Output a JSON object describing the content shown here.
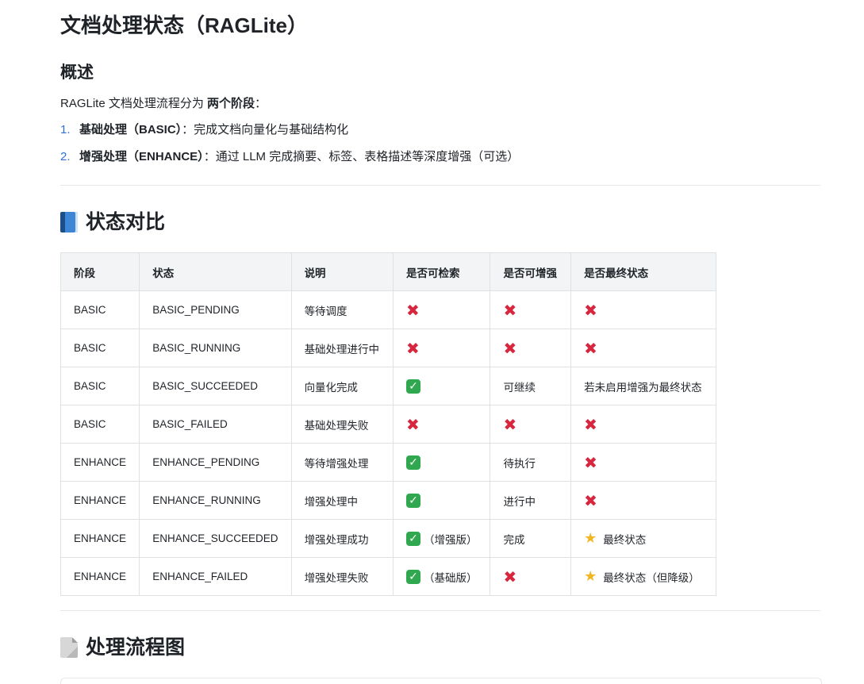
{
  "title": "文档处理状态（RAGLite）",
  "overview": {
    "heading": "概述",
    "intro_prefix": "RAGLite 文档处理流程分为 ",
    "intro_bold": "两个阶段",
    "intro_suffix": "：",
    "stages": [
      {
        "num": "1.",
        "name": "基础处理（BASIC）",
        "desc": "：完成文档向量化与基础结构化"
      },
      {
        "num": "2.",
        "name": "增强处理（ENHANCE）",
        "desc": "：通过 LLM 完成摘要、标签、表格描述等深度增强（可选）"
      }
    ]
  },
  "comparison": {
    "heading": "状态对比",
    "icon": "blue-book-icon",
    "headers": [
      "阶段",
      "状态",
      "说明",
      "是否可检索",
      "是否可增强",
      "是否最终状态"
    ],
    "rows": [
      {
        "stage": "BASIC",
        "status": "BASIC_PENDING",
        "desc": "等待调度",
        "searchable": {
          "mark": "cross",
          "note": ""
        },
        "enhanceable": {
          "mark": "cross",
          "note": ""
        },
        "final": {
          "mark": "cross",
          "note": ""
        }
      },
      {
        "stage": "BASIC",
        "status": "BASIC_RUNNING",
        "desc": "基础处理进行中",
        "searchable": {
          "mark": "cross",
          "note": ""
        },
        "enhanceable": {
          "mark": "cross",
          "note": ""
        },
        "final": {
          "mark": "cross",
          "note": ""
        }
      },
      {
        "stage": "BASIC",
        "status": "BASIC_SUCCEEDED",
        "desc": "向量化完成",
        "searchable": {
          "mark": "check",
          "note": ""
        },
        "enhanceable": {
          "mark": "",
          "note": "可继续"
        },
        "final": {
          "mark": "",
          "note": "若未启用增强为最终状态"
        }
      },
      {
        "stage": "BASIC",
        "status": "BASIC_FAILED",
        "desc": "基础处理失败",
        "searchable": {
          "mark": "cross",
          "note": ""
        },
        "enhanceable": {
          "mark": "cross",
          "note": ""
        },
        "final": {
          "mark": "cross",
          "note": ""
        }
      },
      {
        "stage": "ENHANCE",
        "status": "ENHANCE_PENDING",
        "desc": "等待增强处理",
        "searchable": {
          "mark": "check",
          "note": ""
        },
        "enhanceable": {
          "mark": "",
          "note": "待执行"
        },
        "final": {
          "mark": "cross",
          "note": ""
        }
      },
      {
        "stage": "ENHANCE",
        "status": "ENHANCE_RUNNING",
        "desc": "增强处理中",
        "searchable": {
          "mark": "check",
          "note": ""
        },
        "enhanceable": {
          "mark": "",
          "note": "进行中"
        },
        "final": {
          "mark": "cross",
          "note": ""
        }
      },
      {
        "stage": "ENHANCE",
        "status": "ENHANCE_SUCCEEDED",
        "desc": "增强处理成功",
        "searchable": {
          "mark": "check",
          "note": "（增强版）"
        },
        "enhanceable": {
          "mark": "",
          "note": "完成"
        },
        "final": {
          "mark": "star",
          "note": "最终状态"
        }
      },
      {
        "stage": "ENHANCE",
        "status": "ENHANCE_FAILED",
        "desc": "增强处理失败",
        "searchable": {
          "mark": "check",
          "note": "（基础版）"
        },
        "enhanceable": {
          "mark": "cross",
          "note": ""
        },
        "final": {
          "mark": "star",
          "note": "最终状态（但降级）"
        }
      }
    ]
  },
  "flow": {
    "heading": "处理流程图",
    "icon": "page-icon"
  },
  "colors": {
    "list_number": "#2f6fd6",
    "cross": "#d7263d",
    "check": "#2fa84f",
    "star": "#f2b623",
    "header_bg": "#f3f4f6",
    "border": "#dfe2e5"
  }
}
